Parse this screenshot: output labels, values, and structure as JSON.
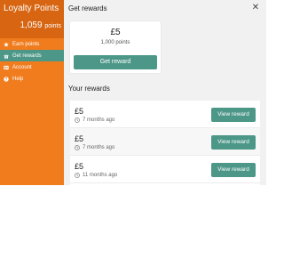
{
  "sidebar": {
    "title": "Loyalty Points",
    "points_value": "1,059",
    "points_unit": "points",
    "items": [
      {
        "label": "Earn points",
        "icon": "star-icon"
      },
      {
        "label": "Get rewards",
        "icon": "gift-icon"
      },
      {
        "label": "Account",
        "icon": "account-icon"
      },
      {
        "label": "Help",
        "icon": "help-icon"
      }
    ]
  },
  "main": {
    "title": "Get rewards",
    "close_icon": "close-icon",
    "reward_card": {
      "amount": "£5",
      "cost": "1,000 points",
      "button_label": "Get reward"
    },
    "your_rewards_title": "Your rewards",
    "rewards": [
      {
        "amount": "£5",
        "time": "7 months ago",
        "button_label": "View reward"
      },
      {
        "amount": "£5",
        "time": "7 months ago",
        "button_label": "View reward"
      },
      {
        "amount": "£5",
        "time": "11 months ago",
        "button_label": "View reward"
      }
    ]
  },
  "colors": {
    "sidebar_bg": "#f07c1e",
    "sidebar_header_bg": "#d76512",
    "accent_teal": "#4c9787",
    "main_bg": "#f1f1f1"
  }
}
